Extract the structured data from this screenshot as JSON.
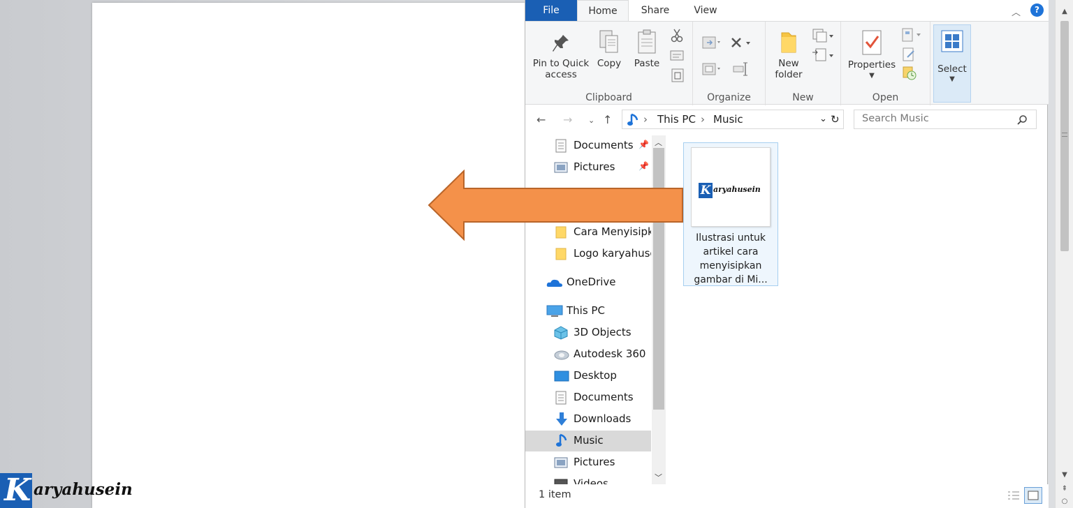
{
  "ribbon_tabs": {
    "file": "File",
    "home": "Home",
    "share": "Share",
    "view": "View",
    "help": "?"
  },
  "ribbon": {
    "pin_label_1": "Pin to Quick",
    "pin_label_2": "access",
    "copy_label": "Copy",
    "paste_label": "Paste",
    "clipboard_group": "Clipboard",
    "organize_group": "Organize",
    "new_folder_1": "New",
    "new_folder_2": "folder",
    "new_group": "New",
    "properties_label": "Properties",
    "open_group": "Open",
    "select_label": "Select"
  },
  "address": {
    "breadcrumb_1": "This PC",
    "breadcrumb_2": "Music",
    "search_placeholder": "Search Music"
  },
  "navpane": {
    "items": [
      {
        "label": "Documents"
      },
      {
        "label": "Pictures"
      },
      {
        "label": "Cara Menyisipkan"
      },
      {
        "label": "Logo karyahusein"
      },
      {
        "label": "OneDrive"
      },
      {
        "label": "This PC"
      },
      {
        "label": "3D Objects"
      },
      {
        "label": "Autodesk 360"
      },
      {
        "label": "Desktop"
      },
      {
        "label": "Documents"
      },
      {
        "label": "Downloads"
      },
      {
        "label": "Music"
      },
      {
        "label": "Pictures"
      },
      {
        "label": "Videos"
      }
    ]
  },
  "content": {
    "file_name_1": "Ilustrasi untuk",
    "file_name_2": "artikel cara",
    "file_name_3": "menyisipkan",
    "file_name_4": "gambar di Mi...",
    "thumb_logo_k": "K",
    "thumb_logo_text": "aryahusein"
  },
  "status": {
    "count": "1 item"
  },
  "watermark": {
    "k": "K",
    "text": "aryahusein"
  },
  "colors": {
    "arrow_fill": "#f4914a",
    "arrow_stroke": "#b9652a",
    "accent": "#1a5fb4"
  }
}
